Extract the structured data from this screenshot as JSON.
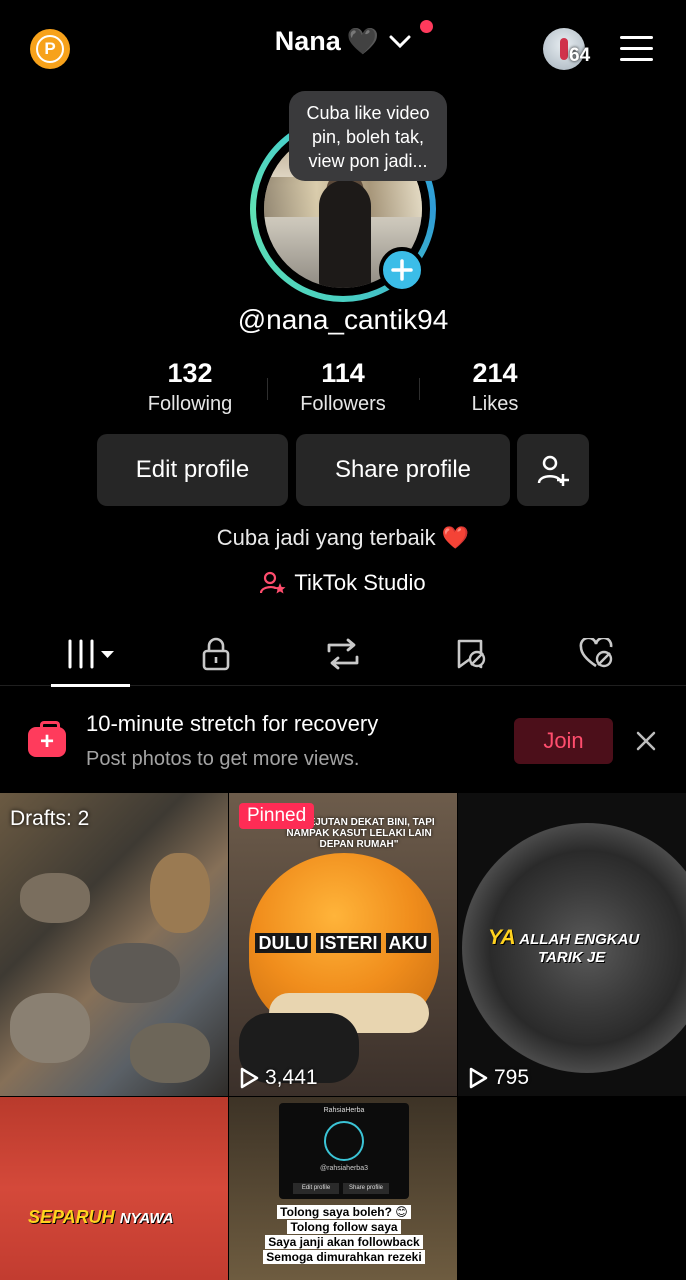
{
  "header": {
    "points_badge": "P",
    "username": "Nana",
    "username_emoji": "🖤",
    "avatar_count": "64"
  },
  "profile": {
    "tooltip": "Cuba like video pin, boleh tak, view pon jadi...",
    "handle": "@nana_cantik94",
    "stats": [
      {
        "value": "132",
        "label": "Following"
      },
      {
        "value": "114",
        "label": "Followers"
      },
      {
        "value": "214",
        "label": "Likes"
      }
    ],
    "edit_label": "Edit profile",
    "share_label": "Share profile",
    "bio": "Cuba jadi yang terbaik",
    "bio_emoji": "❤️",
    "studio_label": "TikTok Studio"
  },
  "tabs": [
    {
      "icon": "grid-icon",
      "active": true
    },
    {
      "icon": "lock-icon"
    },
    {
      "icon": "repost-icon"
    },
    {
      "icon": "bookmark-icon"
    },
    {
      "icon": "heart-hidden-icon"
    }
  ],
  "promo": {
    "icon": "first-aid-icon",
    "title": "10-minute stretch for recovery",
    "subtitle": "Post photos to get more views.",
    "join_label": "Join"
  },
  "videos": [
    {
      "badge": "Drafts: 2"
    },
    {
      "badge": "Pinned",
      "caption_top": "\"GI KEJUTAN DEKAT BINI, TAPI NAMPAK KASUT LELAKI LAIN DEPAN RUMAH\"",
      "caption_a": "DULU",
      "caption_b": "ISTERI",
      "caption_c": "AKU",
      "plays": "3,441"
    },
    {
      "caption_y": "YA",
      "caption_rest": "ALLAH ENGKAU",
      "caption_line2": "TARIK JE",
      "plays": "795"
    },
    {
      "caption_y": "SEPARUH",
      "caption_rest": "NYAWA"
    },
    {
      "mini_name": "RahsiaHerba",
      "mini_handle": "@rahsiaherba3",
      "mini_edit": "Edit profile",
      "mini_share": "Share profile",
      "lines": [
        "Tolong saya boleh? 😊",
        "Tolong follow saya",
        "Saya janji akan followback",
        "Semoga dimurahkan rezeki"
      ]
    }
  ]
}
